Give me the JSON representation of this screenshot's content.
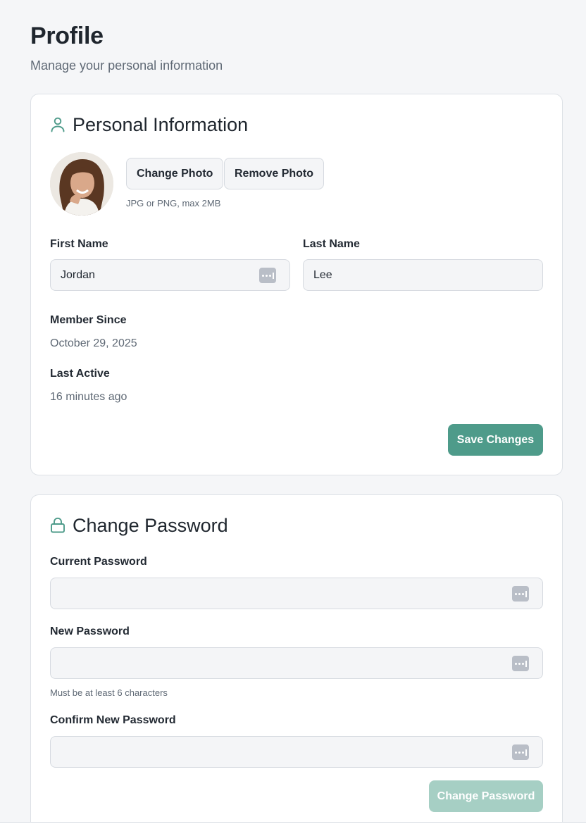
{
  "page": {
    "title": "Profile",
    "subtitle": "Manage your personal information"
  },
  "personal": {
    "title": "Personal Information",
    "icon": "user-icon",
    "photo": {
      "change_label": "Change Photo",
      "remove_label": "Remove Photo",
      "hint": "JPG or PNG, max 2MB"
    },
    "first_name": {
      "label": "First Name",
      "value": "Jordan"
    },
    "last_name": {
      "label": "Last Name",
      "value": "Lee"
    },
    "member_since": {
      "label": "Member Since",
      "value": "October 29, 2025"
    },
    "last_active": {
      "label": "Last Active",
      "value": "16 minutes ago"
    },
    "save_label": "Save Changes"
  },
  "password": {
    "title": "Change Password",
    "icon": "lock-icon",
    "current": {
      "label": "Current Password",
      "value": ""
    },
    "new": {
      "label": "New Password",
      "value": "",
      "hint": "Must be at least 6 characters"
    },
    "confirm": {
      "label": "Confirm New Password",
      "value": ""
    },
    "submit_label": "Change Password"
  },
  "colors": {
    "accent": "#4e9b8a",
    "accent_disabled": "#a6cfc4",
    "background": "#f5f6f8"
  }
}
